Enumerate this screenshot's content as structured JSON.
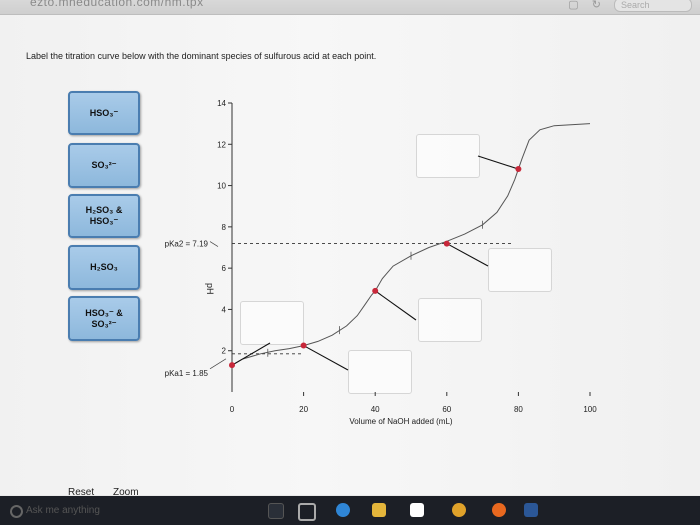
{
  "browser": {
    "url": "ezto.mheducation.com/hm.tpx",
    "search_placeholder": "Search"
  },
  "question": {
    "prompt": "Label the titration curve below with the dominant species of sulfurous acid at each point."
  },
  "tiles": [
    {
      "label": "HSO₃⁻"
    },
    {
      "label": "SO₃²⁻"
    },
    {
      "label": "H₂SO₃ &\nHSO₃⁻"
    },
    {
      "label": "H₂SO₃"
    },
    {
      "label": "HSO₃⁻ &\nSO₃²⁻"
    }
  ],
  "footer": {
    "reset_label": "Reset",
    "zoom_label": "Zoom"
  },
  "taskbar": {
    "search_text": "Ask me anything"
  },
  "chart_data": {
    "type": "line",
    "xlabel": "Volume of NaOH added (mL)",
    "ylabel": "pH",
    "xlim": [
      0,
      100
    ],
    "ylim": [
      0,
      14
    ],
    "x_ticks": [
      0,
      20,
      40,
      60,
      80,
      100
    ],
    "y_ticks": [
      2,
      4,
      6,
      8,
      10,
      12,
      14
    ],
    "annotations": [
      {
        "text": "pKa2 = 7.19",
        "y": 7.19
      },
      {
        "text": "pKa1 = 1.85",
        "y": 1.85
      }
    ],
    "curve": {
      "x": [
        0,
        3,
        8,
        12,
        16,
        20,
        24,
        28,
        32,
        35,
        37,
        39,
        40,
        42,
        45,
        50,
        55,
        60,
        65,
        70,
        74,
        77,
        79,
        80,
        81,
        83,
        86,
        90,
        100
      ],
      "y": [
        1.3,
        1.6,
        1.85,
        2.0,
        2.1,
        2.25,
        2.45,
        2.75,
        3.2,
        3.7,
        4.2,
        4.7,
        4.9,
        5.5,
        6.1,
        6.6,
        7.0,
        7.3,
        7.65,
        8.1,
        8.7,
        9.5,
        10.3,
        10.8,
        11.3,
        12.2,
        12.7,
        12.9,
        13.0
      ]
    },
    "marked_points": [
      {
        "x": 0,
        "y": 1.3
      },
      {
        "x": 20,
        "y": 2.25
      },
      {
        "x": 40,
        "y": 4.9
      },
      {
        "x": 60,
        "y": 7.19
      },
      {
        "x": 80,
        "y": 10.8
      }
    ]
  }
}
